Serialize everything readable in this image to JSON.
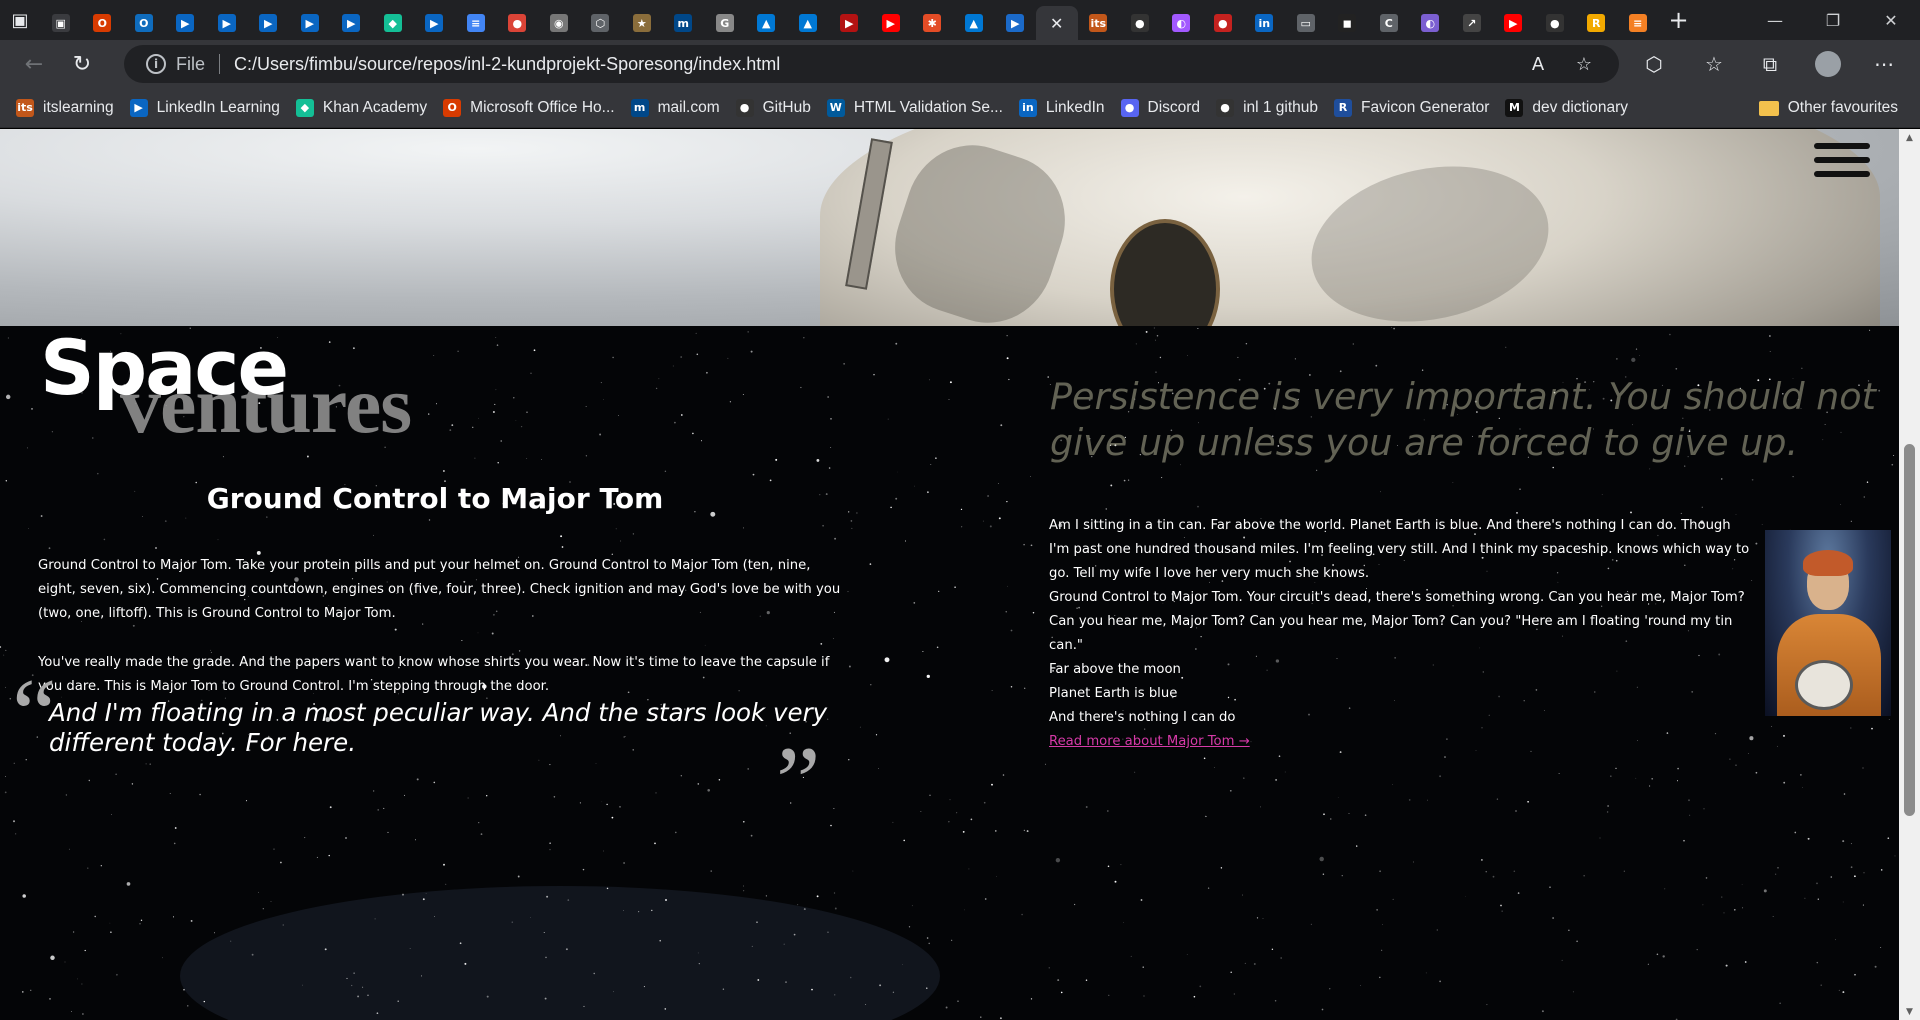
{
  "browser": {
    "tabs": [
      {
        "icon": "sidebar-icon",
        "color": "#3a3b3f",
        "glyph": "▣"
      },
      {
        "icon": "office-icon",
        "color": "#d83b01",
        "glyph": "O"
      },
      {
        "icon": "outlook-icon",
        "color": "#0f6cbd",
        "glyph": "O"
      },
      {
        "icon": "linkedin-learning-icon",
        "color": "#0a66c2",
        "glyph": "▶"
      },
      {
        "icon": "linkedin-learning-icon",
        "color": "#0a66c2",
        "glyph": "▶"
      },
      {
        "icon": "linkedin-learning-icon",
        "color": "#0a66c2",
        "glyph": "▶"
      },
      {
        "icon": "linkedin-learning-icon",
        "color": "#0a66c2",
        "glyph": "▶"
      },
      {
        "icon": "linkedin-learning-icon",
        "color": "#0a66c2",
        "glyph": "▶"
      },
      {
        "icon": "khan-academy-icon",
        "color": "#14bf96",
        "glyph": "◆"
      },
      {
        "icon": "linkedin-learning-icon",
        "color": "#0a66c2",
        "glyph": "▶"
      },
      {
        "icon": "google-docs-icon",
        "color": "#4285f4",
        "glyph": "≡"
      },
      {
        "icon": "chrome-icon",
        "color": "#db4437",
        "glyph": "●"
      },
      {
        "icon": "screenshot-icon",
        "color": "#777777",
        "glyph": "◉"
      },
      {
        "icon": "extension-icon",
        "color": "#5f6368",
        "glyph": "⬡"
      },
      {
        "icon": "star-icon",
        "color": "#8a6d3b",
        "glyph": "★"
      },
      {
        "icon": "mail-com-icon",
        "color": "#004788",
        "glyph": "m"
      },
      {
        "icon": "g-icon",
        "color": "#888888",
        "glyph": "G"
      },
      {
        "icon": "azure-icon",
        "color": "#0078d4",
        "glyph": "▲"
      },
      {
        "icon": "azure-icon",
        "color": "#0078d4",
        "glyph": "▲"
      },
      {
        "icon": "youtube-icon",
        "color": "#b31212",
        "glyph": "▶"
      },
      {
        "icon": "youtube-icon",
        "color": "#ff0000",
        "glyph": "▶"
      },
      {
        "icon": "asterisk-icon",
        "color": "#e34c26",
        "glyph": "✱"
      },
      {
        "icon": "azure-icon",
        "color": "#0078d4",
        "glyph": "▲"
      },
      {
        "icon": "video-icon",
        "color": "#1b6ac9",
        "glyph": "▶"
      },
      {
        "icon": "close-icon",
        "color": "#35363a",
        "glyph": "✕",
        "active": true
      },
      {
        "icon": "its-icon",
        "color": "#c2571a",
        "glyph": "its"
      },
      {
        "icon": "github-icon",
        "color": "#333333",
        "glyph": "●"
      },
      {
        "icon": "figma-icon",
        "color": "#a259ff",
        "glyph": "◐"
      },
      {
        "icon": "pin-icon",
        "color": "#c5221f",
        "glyph": "●"
      },
      {
        "icon": "linkedin-icon",
        "color": "#0a66c2",
        "glyph": "in"
      },
      {
        "icon": "document-icon",
        "color": "#5f6368",
        "glyph": "▭"
      },
      {
        "icon": "media-icon",
        "color": "#222222",
        "glyph": "◼"
      },
      {
        "icon": "c-icon",
        "color": "#5f6368",
        "glyph": "C"
      },
      {
        "icon": "figma-icon",
        "color": "#7b5fd1",
        "glyph": "◐"
      },
      {
        "icon": "external-icon",
        "color": "#444444",
        "glyph": "↗"
      },
      {
        "icon": "youtube-icon",
        "color": "#ff0000",
        "glyph": "▶"
      },
      {
        "icon": "github-icon",
        "color": "#333333",
        "glyph": "●"
      },
      {
        "icon": "r-icon",
        "color": "#f2a900",
        "glyph": "R"
      },
      {
        "icon": "stack-icon",
        "color": "#f48024",
        "glyph": "≡"
      }
    ],
    "address": {
      "scheme_label": "File",
      "url": "C:/Users/fimbu/source/repos/inl-2-kundprojekt-Sporesong/index.html"
    },
    "bookmarks": [
      {
        "label": "itslearning",
        "icon": "itslearning-icon",
        "color": "#c2571a",
        "glyph": "its"
      },
      {
        "label": "LinkedIn Learning",
        "icon": "linkedin-learning-icon",
        "color": "#0a66c2",
        "glyph": "▶"
      },
      {
        "label": "Khan Academy",
        "icon": "khan-academy-icon",
        "color": "#14bf96",
        "glyph": "◆"
      },
      {
        "label": "Microsoft Office Ho...",
        "icon": "office-icon",
        "color": "#d83b01",
        "glyph": "O"
      },
      {
        "label": "mail.com",
        "icon": "mail-com-icon",
        "color": "#004788",
        "glyph": "m"
      },
      {
        "label": "GitHub",
        "icon": "github-icon",
        "color": "#333333",
        "glyph": "●"
      },
      {
        "label": "HTML Validation Se...",
        "icon": "w3c-icon",
        "color": "#005a9c",
        "glyph": "W"
      },
      {
        "label": "LinkedIn",
        "icon": "linkedin-icon",
        "color": "#0a66c2",
        "glyph": "in"
      },
      {
        "label": "Discord",
        "icon": "discord-icon",
        "color": "#5865f2",
        "glyph": "●"
      },
      {
        "label": "inl 1 github",
        "icon": "github-icon",
        "color": "#333333",
        "glyph": "●"
      },
      {
        "label": "Favicon Generator",
        "icon": "favicon-generator-icon",
        "color": "#1f4e9c",
        "glyph": "R"
      },
      {
        "label": "dev dictionary",
        "icon": "dev-dictionary-icon",
        "color": "#111111",
        "glyph": "M"
      }
    ],
    "other_favourites": "Other favourites"
  },
  "page": {
    "logo_primary": "Space",
    "logo_secondary": "ventures",
    "left_heading": "Ground Control to Major Tom",
    "left_para_1": "Ground Control to Major Tom. Take your protein pills and put your helmet on. Ground Control to Major Tom (ten, nine, eight, seven, six). Commencing countdown, engines on (five, four, three). Check ignition and may God's love be with you (two, one, liftoff). This is Ground Control to Major Tom.",
    "left_para_2": "You've really made the grade. And the papers want to know whose shirts you wear. Now it's time to leave the capsule if you dare. This is Major Tom to Ground Control. I'm stepping through the door.",
    "quote_open": "“",
    "quote": "And I'm floating in a most peculiar way. And the stars look very different today. For here.",
    "quote_close": "”",
    "persistence_quote": "Persistence is very important. You should not give up unless you are forced to give up.",
    "right_para_1": "Am I sitting in a tin can. Far above the world. Planet Earth is blue. And there's nothing I can do. Though I'm past one hundred thousand miles. I'm feeling very still. And I think my spaceship. knows which way to go. Tell my wife I love her very much she knows.",
    "right_para_2": "Ground Control to Major Tom. Your circuit's dead, there's something wrong. Can you hear me, Major Tom? Can you hear me, Major Tom? Can you hear me, Major Tom? Can you? \"Here am I floating 'round my tin can.\"",
    "right_lines": [
      "Far above the moon",
      "Planet Earth is blue",
      "And there's nothing I can do"
    ],
    "read_more": "Read more about Major Tom →"
  },
  "colors": {
    "link": "#d63aa8",
    "persistence": "#b9b89c",
    "background": "#040507"
  }
}
